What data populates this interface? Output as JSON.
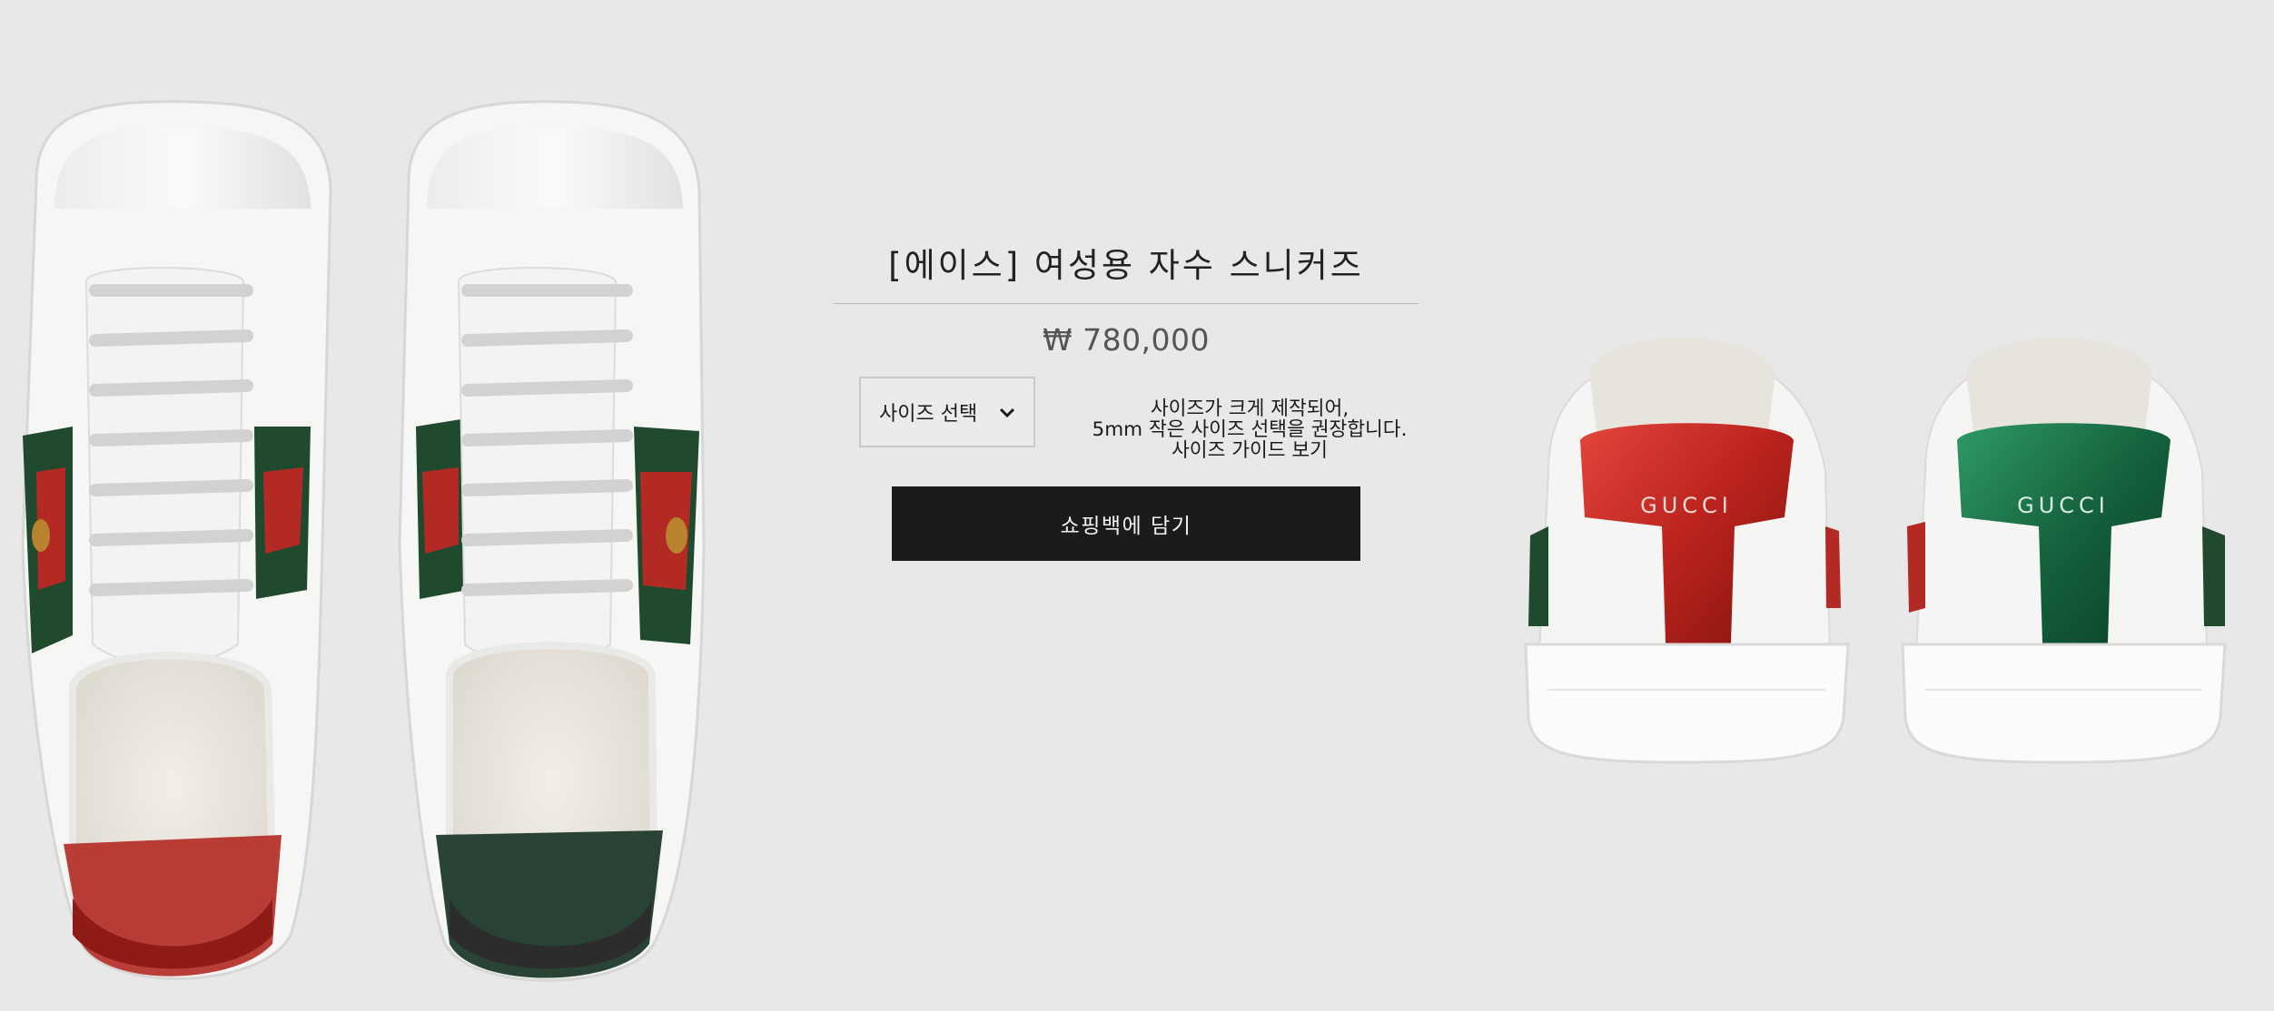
{
  "product": {
    "title": "[에이스] 여성용 자수 스니커즈",
    "price": "₩ 780,000",
    "size_select": {
      "label": "사이즈 선택",
      "icon": "chevron-down-icon"
    },
    "size_note": {
      "line1": "사이즈가 크게 제작되어,",
      "line2": "5mm 작은 사이즈 선택을 권장합니다.",
      "guide_link": "사이즈 가이드 보기"
    },
    "add_to_bag_label": "쇼핑백에 담기"
  },
  "images": {
    "top_view": {
      "alt": "top view of white leather sneakers with green-red-green web stripe and embroidered bee"
    },
    "back_view": {
      "alt": "rear view of white leather sneakers with red and green metallic heel counters",
      "heel_text": "GUCCI"
    }
  },
  "colors": {
    "background": "#e8e8e8",
    "button_bg": "#1b1b1b",
    "button_text": "#f3f3f3",
    "stripe_green": "#1f4a2e",
    "stripe_red": "#b32a24",
    "heel_red": "#b8221c",
    "heel_green": "#14603c"
  }
}
